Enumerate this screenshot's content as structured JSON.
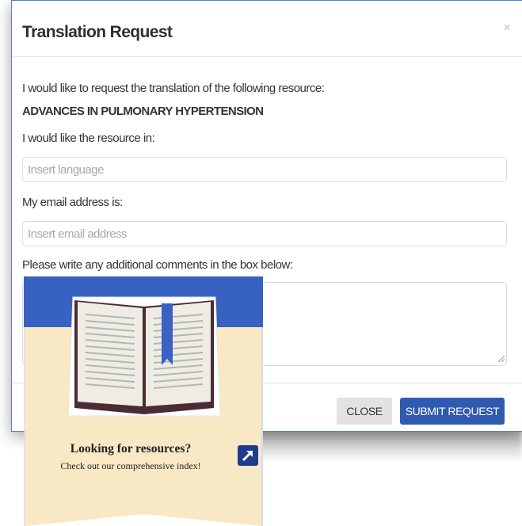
{
  "modal": {
    "title": "Translation Request",
    "close_symbol": "×",
    "intro": "I would like to request the translation of the following resource:",
    "resource_name": "ADVANCES IN PULMONARY HYPERTENSION",
    "language_label": "I would like the resource in:",
    "language_placeholder": "Insert language",
    "email_label": "My email address is:",
    "email_placeholder": "Insert email address",
    "comments_label": "Please write any additional comments in the box below:",
    "close_button": "CLOSE",
    "submit_button": "SUBMIT REQUEST",
    "colors": {
      "primary": "#2f5ab0",
      "border": "#5a7fc8"
    }
  },
  "promo": {
    "title": "Looking for resources?",
    "subtitle": "Check out our comprehensive index!",
    "icon": "open-book-icon",
    "link_icon": "external-arrow-icon",
    "colors": {
      "banner": "#f9e8c4",
      "header": "#3762c1",
      "book_spine": "#3a62c4"
    }
  }
}
